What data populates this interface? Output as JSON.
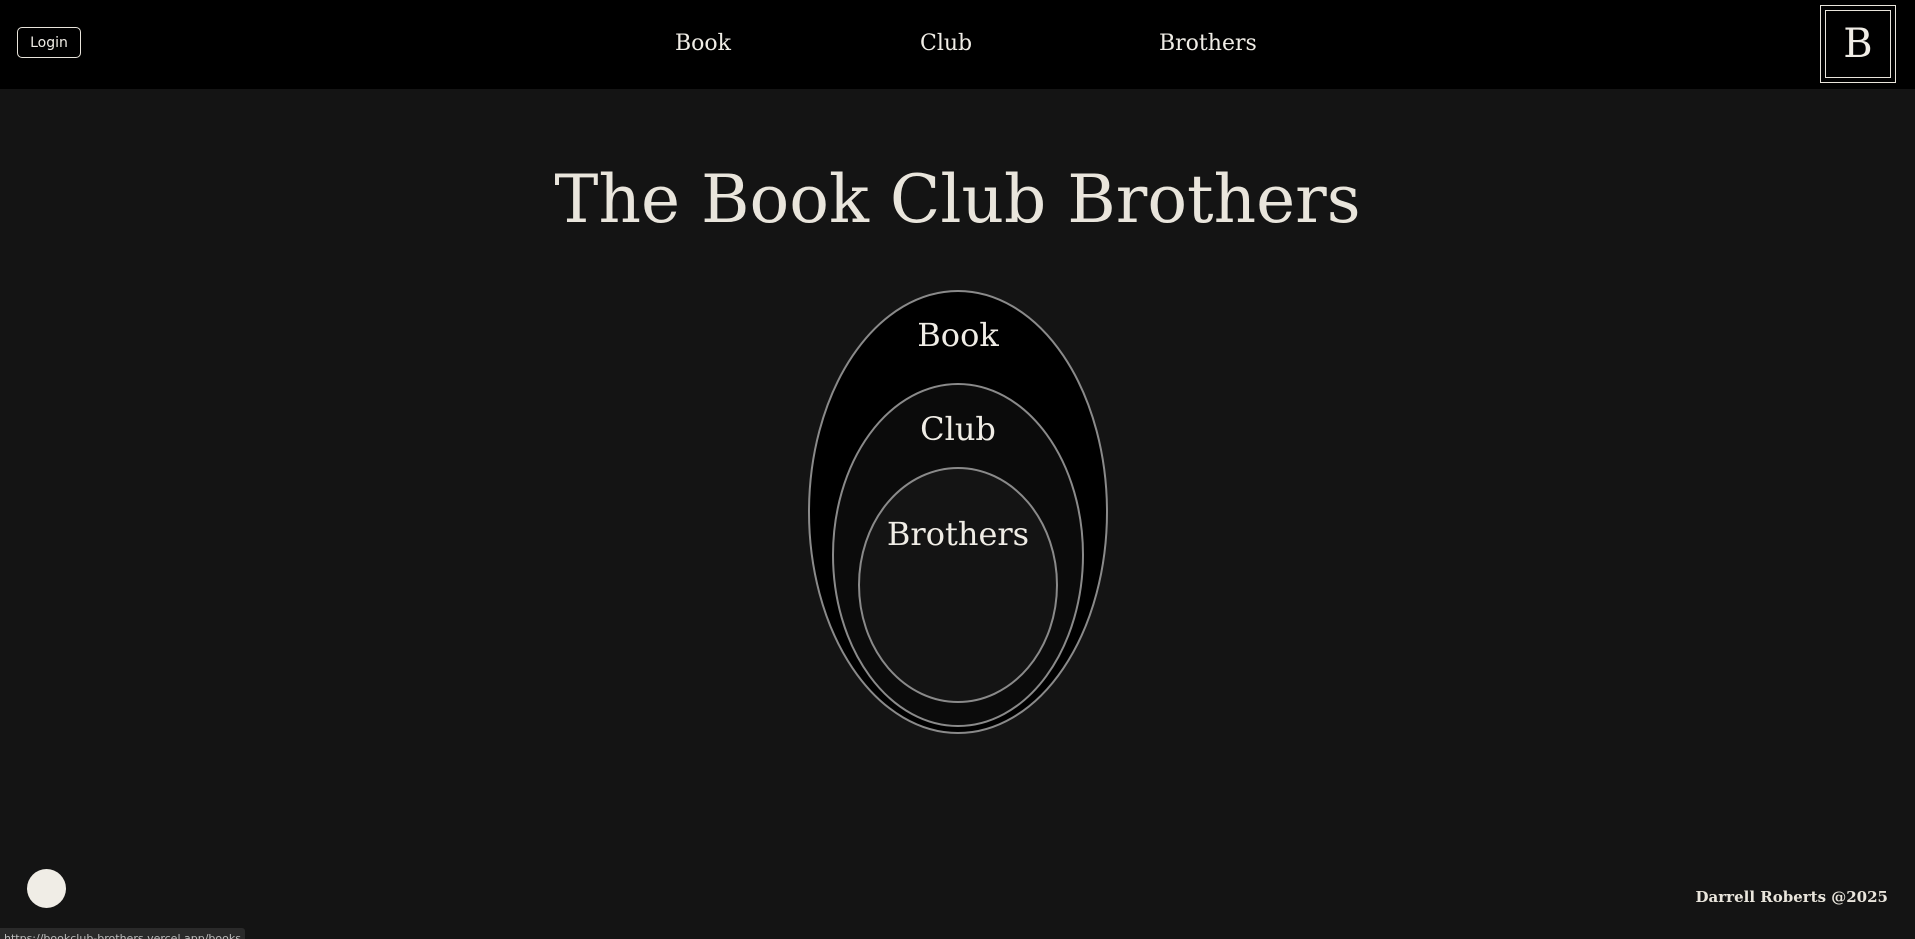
{
  "header": {
    "login_label": "Login",
    "nav": [
      {
        "label": "Book"
      },
      {
        "label": "Club"
      },
      {
        "label": "Brothers"
      }
    ],
    "logo_letter": "B"
  },
  "main": {
    "title": "The Book Club Brothers",
    "rings": [
      {
        "label": "Book"
      },
      {
        "label": "Club"
      },
      {
        "label": "Brothers"
      }
    ]
  },
  "footer": {
    "credit": "Darrell Roberts @2025"
  },
  "status_bar": {
    "url": "https://bookclub-brothers.vercel.app/books"
  },
  "colors": {
    "page_bg": "#141414",
    "header_bg": "#000000",
    "text": "#f0ede6",
    "ring_stroke": "#8a8a8a"
  }
}
